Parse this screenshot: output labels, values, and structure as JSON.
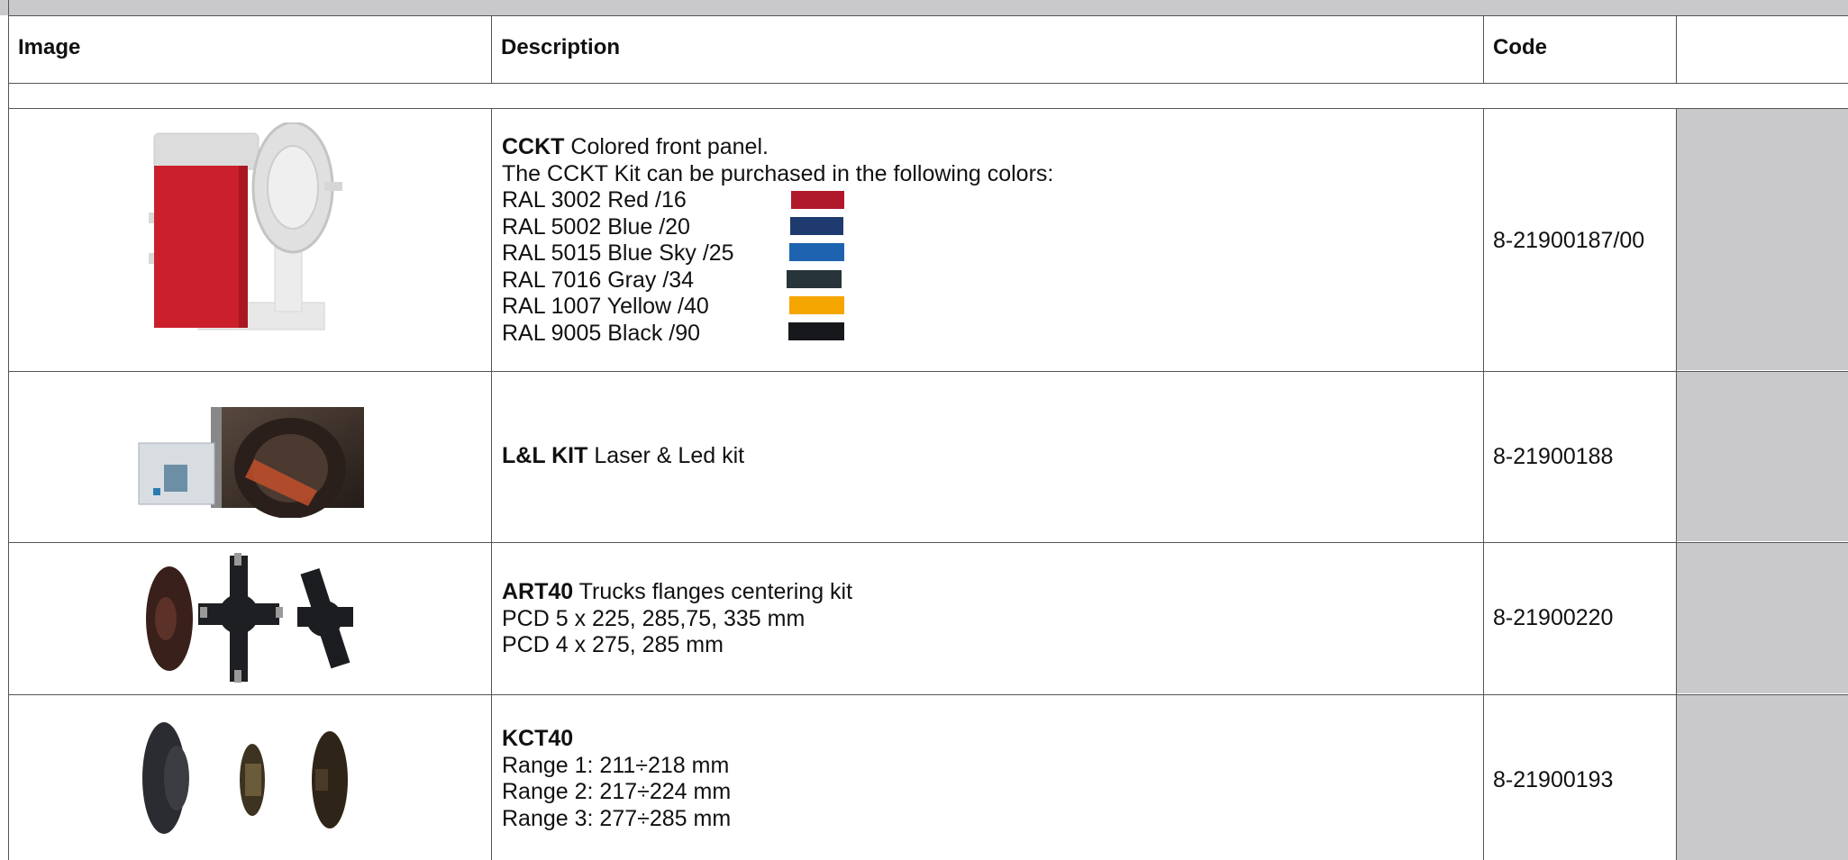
{
  "header": {
    "image": "Image",
    "description": "Description",
    "code": "Code"
  },
  "rows": [
    {
      "name": "CCKT",
      "name_suffix": " Colored front panel.",
      "lines": [
        "The CCKT Kit can be purchased in the following colors:"
      ],
      "colors": [
        {
          "label": "RAL 3002 Red /16",
          "hex": "#b0182c"
        },
        {
          "label": "RAL 5002 Blue /20",
          "hex": "#1e3a6e"
        },
        {
          "label": "RAL 5015 Blue Sky /25",
          "hex": "#1d63b0"
        },
        {
          "label": "RAL 7016 Gray /34",
          "hex": "#27343a"
        },
        {
          "label": "RAL 1007 Yellow /40",
          "hex": "#f5a500"
        },
        {
          "label": "RAL 9005 Black /90",
          "hex": "#17181c"
        }
      ],
      "code": "8-21900187/00",
      "image_icon": "wheel-balancer-image"
    },
    {
      "name": "L&L KIT",
      "name_suffix": " Laser & Led kit",
      "lines": [],
      "code": "8-21900188",
      "image_icon": "laser-led-kit-image"
    },
    {
      "name": "ART40",
      "name_suffix": " Trucks flanges centering kit",
      "lines": [
        "PCD 5 x 225, 285,75, 335 mm",
        "PCD 4 x 275, 285 mm"
      ],
      "code": "8-21900220",
      "image_icon": "truck-flanges-image"
    },
    {
      "name": "KCT40",
      "name_suffix": "",
      "lines": [
        "Range 1: 211÷218 mm",
        "Range 2: 217÷224 mm",
        "Range 3: 277÷285 mm"
      ],
      "code": "8-21900193",
      "image_icon": "centering-cones-image"
    }
  ]
}
